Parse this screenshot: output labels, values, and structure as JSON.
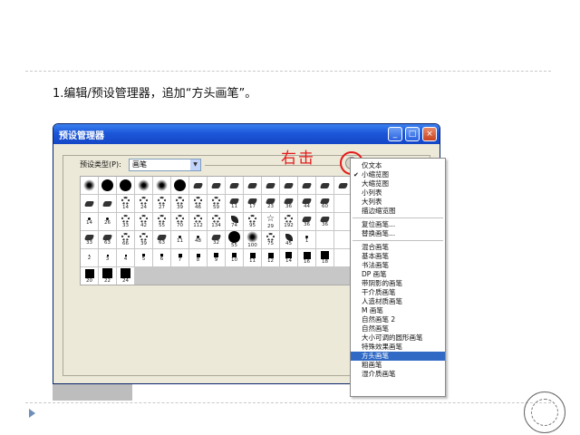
{
  "instruction": "1.编辑/预设管理器，追加“方头画笔”。",
  "callout": "右击",
  "dialog": {
    "title": "预设管理器",
    "preset_type_label": "预设类型(P):",
    "preset_type_value": "画笔",
    "menu_button_glyph": "▸",
    "window_buttons": [
      "_",
      "□",
      "×"
    ]
  },
  "brushes": [
    {
      "size": "",
      "shape": "soft"
    },
    {
      "size": "",
      "shape": "hard-large"
    },
    {
      "size": "",
      "shape": "hard-large"
    },
    {
      "size": "",
      "shape": "soft"
    },
    {
      "size": "",
      "shape": "soft"
    },
    {
      "size": "",
      "shape": "hard-large"
    },
    {
      "size": "",
      "shape": "ink"
    },
    {
      "size": "",
      "shape": "ink"
    },
    {
      "size": "",
      "shape": "ink"
    },
    {
      "size": "",
      "shape": "ink"
    },
    {
      "size": "",
      "shape": "ink"
    },
    {
      "size": "",
      "shape": "ink"
    },
    {
      "size": "",
      "shape": "ink"
    },
    {
      "size": "",
      "shape": "ink"
    },
    {
      "size": "",
      "shape": "ink"
    },
    {
      "size": "",
      "shape": "ink"
    },
    {
      "size": "",
      "shape": "ink"
    },
    {
      "size": "14",
      "shape": "splat"
    },
    {
      "size": "24",
      "shape": "splat"
    },
    {
      "size": "27",
      "shape": "splat"
    },
    {
      "size": "39",
      "shape": "splat"
    },
    {
      "size": "46",
      "shape": "splat"
    },
    {
      "size": "59",
      "shape": "splat"
    },
    {
      "size": "11",
      "shape": "ink"
    },
    {
      "size": "17",
      "shape": "ink"
    },
    {
      "size": "23",
      "shape": "ink"
    },
    {
      "size": "36",
      "shape": "ink"
    },
    {
      "size": "44",
      "shape": "ink"
    },
    {
      "size": "60",
      "shape": "ink"
    },
    {
      "size": "",
      "shape": "blank"
    },
    {
      "size": "14",
      "shape": "dot"
    },
    {
      "size": "26",
      "shape": "dot"
    },
    {
      "size": "33",
      "shape": "splat"
    },
    {
      "size": "42",
      "shape": "splat"
    },
    {
      "size": "55",
      "shape": "splat"
    },
    {
      "size": "70",
      "shape": "splat"
    },
    {
      "size": "112",
      "shape": "splat"
    },
    {
      "size": "134",
      "shape": "splat"
    },
    {
      "size": "74",
      "shape": "leaf"
    },
    {
      "size": "95",
      "shape": "splat"
    },
    {
      "size": "29",
      "shape": "star"
    },
    {
      "size": "192",
      "shape": "splat"
    },
    {
      "size": "36",
      "shape": "ink"
    },
    {
      "size": "36",
      "shape": "ink"
    },
    {
      "size": "",
      "shape": "blank"
    },
    {
      "size": "33",
      "shape": "ink"
    },
    {
      "size": "63",
      "shape": "ink"
    },
    {
      "size": "66",
      "shape": "splat"
    },
    {
      "size": "39",
      "shape": "splat"
    },
    {
      "size": "63",
      "shape": "ink"
    },
    {
      "size": "11",
      "shape": "dot"
    },
    {
      "size": "48",
      "shape": "dot"
    },
    {
      "size": "32",
      "shape": "ink"
    },
    {
      "size": "55",
      "shape": "hard-large"
    },
    {
      "size": "100",
      "shape": "soft"
    },
    {
      "size": "75",
      "shape": "splat"
    },
    {
      "size": "45",
      "shape": "leaf"
    },
    {
      "size": "1",
      "shape": "dot"
    },
    {
      "size": "",
      "shape": "blank"
    },
    {
      "size": "",
      "shape": "blank"
    },
    {
      "size": "2",
      "shape": "square"
    },
    {
      "size": "3",
      "shape": "square"
    },
    {
      "size": "4",
      "shape": "square"
    },
    {
      "size": "5",
      "shape": "square"
    },
    {
      "size": "6",
      "shape": "square"
    },
    {
      "size": "7",
      "shape": "square"
    },
    {
      "size": "8",
      "shape": "square"
    },
    {
      "size": "9",
      "shape": "square"
    },
    {
      "size": "10",
      "shape": "square"
    },
    {
      "size": "11",
      "shape": "square"
    },
    {
      "size": "12",
      "shape": "square"
    },
    {
      "size": "14",
      "shape": "square"
    },
    {
      "size": "16",
      "shape": "square"
    },
    {
      "size": "18",
      "shape": "square"
    },
    {
      "size": "",
      "shape": "blank"
    },
    {
      "size": "20",
      "shape": "square"
    },
    {
      "size": "22",
      "shape": "square"
    },
    {
      "size": "24",
      "shape": "square"
    }
  ],
  "context_menu": {
    "items": [
      {
        "label": "仅文本",
        "checked": false,
        "selected": false
      },
      {
        "label": "小缩览图",
        "checked": true,
        "selected": false
      },
      {
        "label": "大缩览图",
        "checked": false,
        "selected": false
      },
      {
        "label": "小列表",
        "checked": false,
        "selected": false
      },
      {
        "label": "大列表",
        "checked": false,
        "selected": false
      },
      {
        "label": "描边缩览图",
        "checked": false,
        "selected": false
      },
      {
        "separator": true
      },
      {
        "label": "复位画笔...",
        "checked": false,
        "selected": false
      },
      {
        "label": "替换画笔...",
        "checked": false,
        "selected": false
      },
      {
        "separator": true
      },
      {
        "label": "混合画笔",
        "checked": false,
        "selected": false
      },
      {
        "label": "基本画笔",
        "checked": false,
        "selected": false
      },
      {
        "label": "书法画笔",
        "checked": false,
        "selected": false
      },
      {
        "label": "DP 画笔",
        "checked": false,
        "selected": false
      },
      {
        "label": "带阴影的画笔",
        "checked": false,
        "selected": false
      },
      {
        "label": "干介质画笔",
        "checked": false,
        "selected": false
      },
      {
        "label": "人造材质画笔",
        "checked": false,
        "selected": false
      },
      {
        "label": "M 画笔",
        "checked": false,
        "selected": false
      },
      {
        "label": "自然画笔 2",
        "checked": false,
        "selected": false
      },
      {
        "label": "自然画笔",
        "checked": false,
        "selected": false
      },
      {
        "label": "大小可调的圆形画笔",
        "checked": false,
        "selected": false
      },
      {
        "label": "特殊效果画笔",
        "checked": false,
        "selected": false
      },
      {
        "label": "方头画笔",
        "checked": false,
        "selected": true
      },
      {
        "label": "粗画笔",
        "checked": false,
        "selected": false
      },
      {
        "label": "湿介质画笔",
        "checked": false,
        "selected": false
      }
    ]
  }
}
